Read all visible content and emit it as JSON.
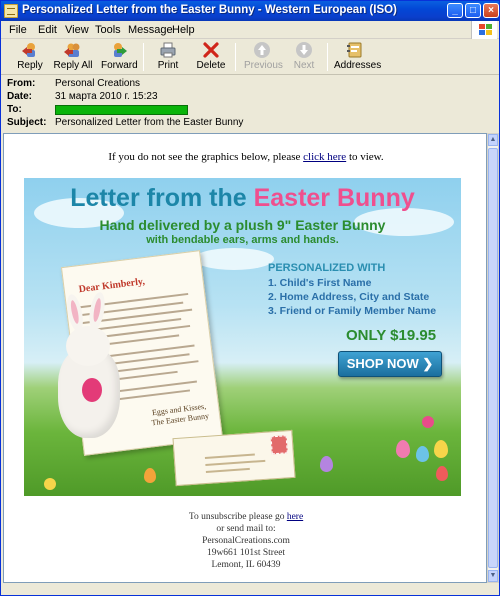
{
  "window": {
    "title": "Personalized Letter from the Easter Bunny - Western European (ISO)",
    "controls": {
      "minimize": "_",
      "maximize": "□",
      "close": "×"
    }
  },
  "menu": [
    "File",
    "Edit",
    "View",
    "Tools",
    "Message",
    "Help"
  ],
  "toolbar": {
    "reply": "Reply",
    "reply_all": "Reply All",
    "forward": "Forward",
    "print": "Print",
    "delete": "Delete",
    "previous": "Previous",
    "next": "Next",
    "addresses": "Addresses"
  },
  "headers": {
    "from_label": "From:",
    "from_value": "Personal Creations",
    "date_label": "Date:",
    "date_value": "31 марта 2010 г. 15:23",
    "to_label": "To:",
    "subject_label": "Subject:",
    "subject_value": "Personalized Letter from the Easter Bunny"
  },
  "body": {
    "notice_pre": "If you do not see the graphics below, please ",
    "notice_link": "click here",
    "notice_post": " to view.",
    "banner": {
      "title_a": "Letter from the ",
      "title_b": "Easter Bunny",
      "subtitle1": "Hand delivered by a plush 9\" Easter Bunny",
      "subtitle2": "with bendable ears, arms and hands.",
      "letter_greeting": "Dear Kimberly,",
      "letter_sign": "Eggs and Kisses,\nThe Easter Bunny",
      "personalized_title": "PERSONALIZED WITH",
      "personalized_items": [
        "1. Child's First Name",
        "2. Home Address, City and State",
        "3. Friend or Family Member Name"
      ],
      "price": "ONLY $19.95",
      "shop_button": "SHOP NOW ❯"
    },
    "footer": {
      "unsub_pre": "To unsubscribe please go ",
      "unsub_link": "here",
      "mail_line": "or send mail to:",
      "company": "PersonalCreations.com",
      "street": "19w661 101st Street",
      "city": "Lemont, IL 60439"
    }
  },
  "colors": {
    "titlebar": "#0a5fe0",
    "to_redaction": "#0ab40a",
    "banner_title": "#1c86a8",
    "banner_pink": "#ef4f8e",
    "banner_green": "#2b8c2f"
  }
}
